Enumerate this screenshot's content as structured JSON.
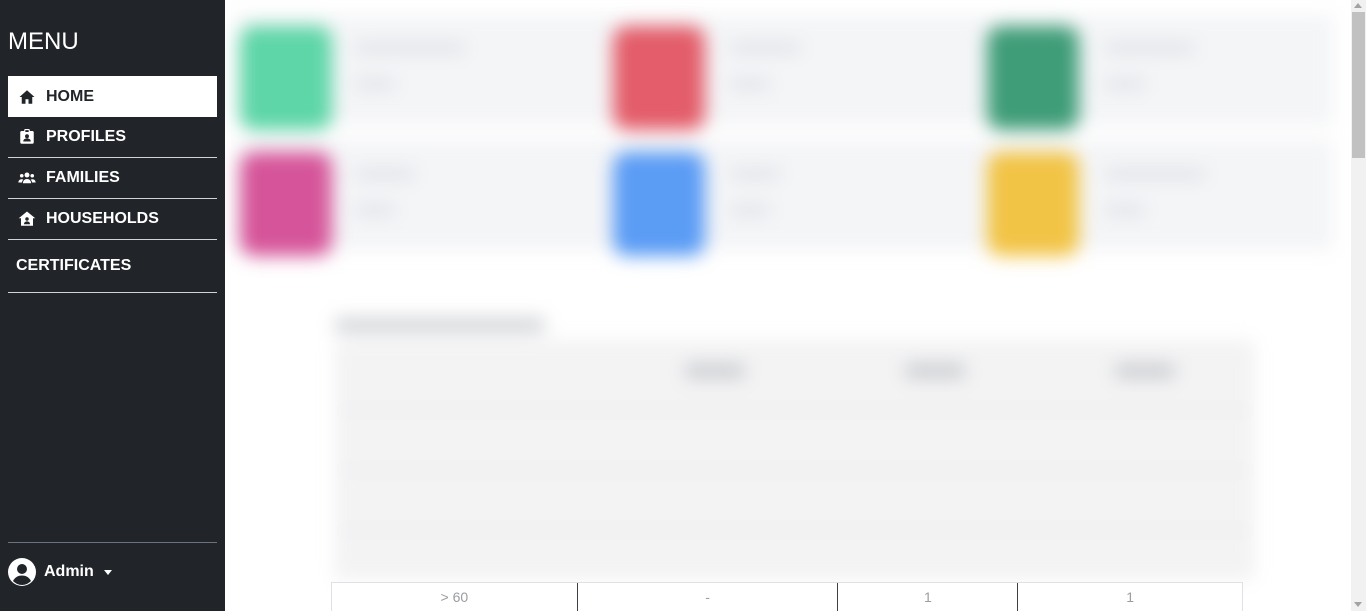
{
  "sidebar": {
    "title": "MENU",
    "items": [
      {
        "label": "HOME",
        "icon": "home-icon",
        "active": true
      },
      {
        "label": "PROFILES",
        "icon": "id-badge-icon"
      },
      {
        "label": "FAMILIES",
        "icon": "users-icon"
      },
      {
        "label": "HOUSEHOLDS",
        "icon": "house-user-icon"
      },
      {
        "label": "CERTIFICATES"
      }
    ],
    "user": {
      "name": "Admin",
      "icon": "user-circle-icon"
    }
  },
  "dashboard": {
    "card_colors": [
      "#5ed6a8",
      "#e35d6a",
      "#3f9d78",
      "#d6559a",
      "#5b9cf5",
      "#f2c446"
    ]
  },
  "table": {
    "visible_row": [
      "> 60",
      "-",
      "1",
      "1"
    ]
  },
  "colors": {
    "sidebar_bg": "#212529",
    "active_item_bg": "#ffffff"
  }
}
